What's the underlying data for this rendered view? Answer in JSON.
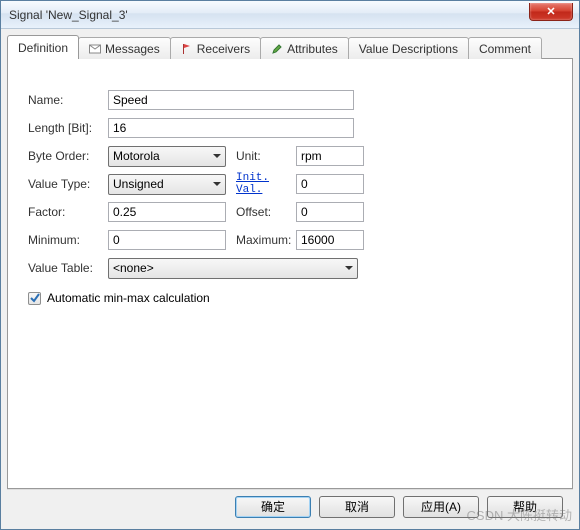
{
  "window": {
    "title": "Signal 'New_Signal_3'",
    "close_glyph": "✕"
  },
  "tabs": {
    "definition": "Definition",
    "messages": "Messages",
    "receivers": "Receivers",
    "attributes": "Attributes",
    "value_descriptions": "Value Descriptions",
    "comment": "Comment"
  },
  "labels": {
    "name": "Name:",
    "length": "Length [Bit]:",
    "byte_order": "Byte Order:",
    "unit": "Unit:",
    "value_type": "Value Type:",
    "init_val": "Init. Val.",
    "factor": "Factor:",
    "offset": "Offset:",
    "minimum": "Minimum:",
    "maximum": "Maximum:",
    "value_table": "Value Table:",
    "auto_minmax": "Automatic min-max calculation"
  },
  "values": {
    "name": "Speed",
    "length": "16",
    "byte_order": "Motorola",
    "unit": "rpm",
    "value_type": "Unsigned",
    "init_val": "0",
    "factor": "0.25",
    "offset": "0",
    "minimum": "0",
    "maximum": "16000",
    "value_table": "<none>",
    "auto_minmax_checked": true
  },
  "buttons": {
    "ok": "确定",
    "cancel": "取消",
    "apply": "应用(A)",
    "help": "帮助"
  },
  "watermark": "CSDN 大陈挺转动"
}
